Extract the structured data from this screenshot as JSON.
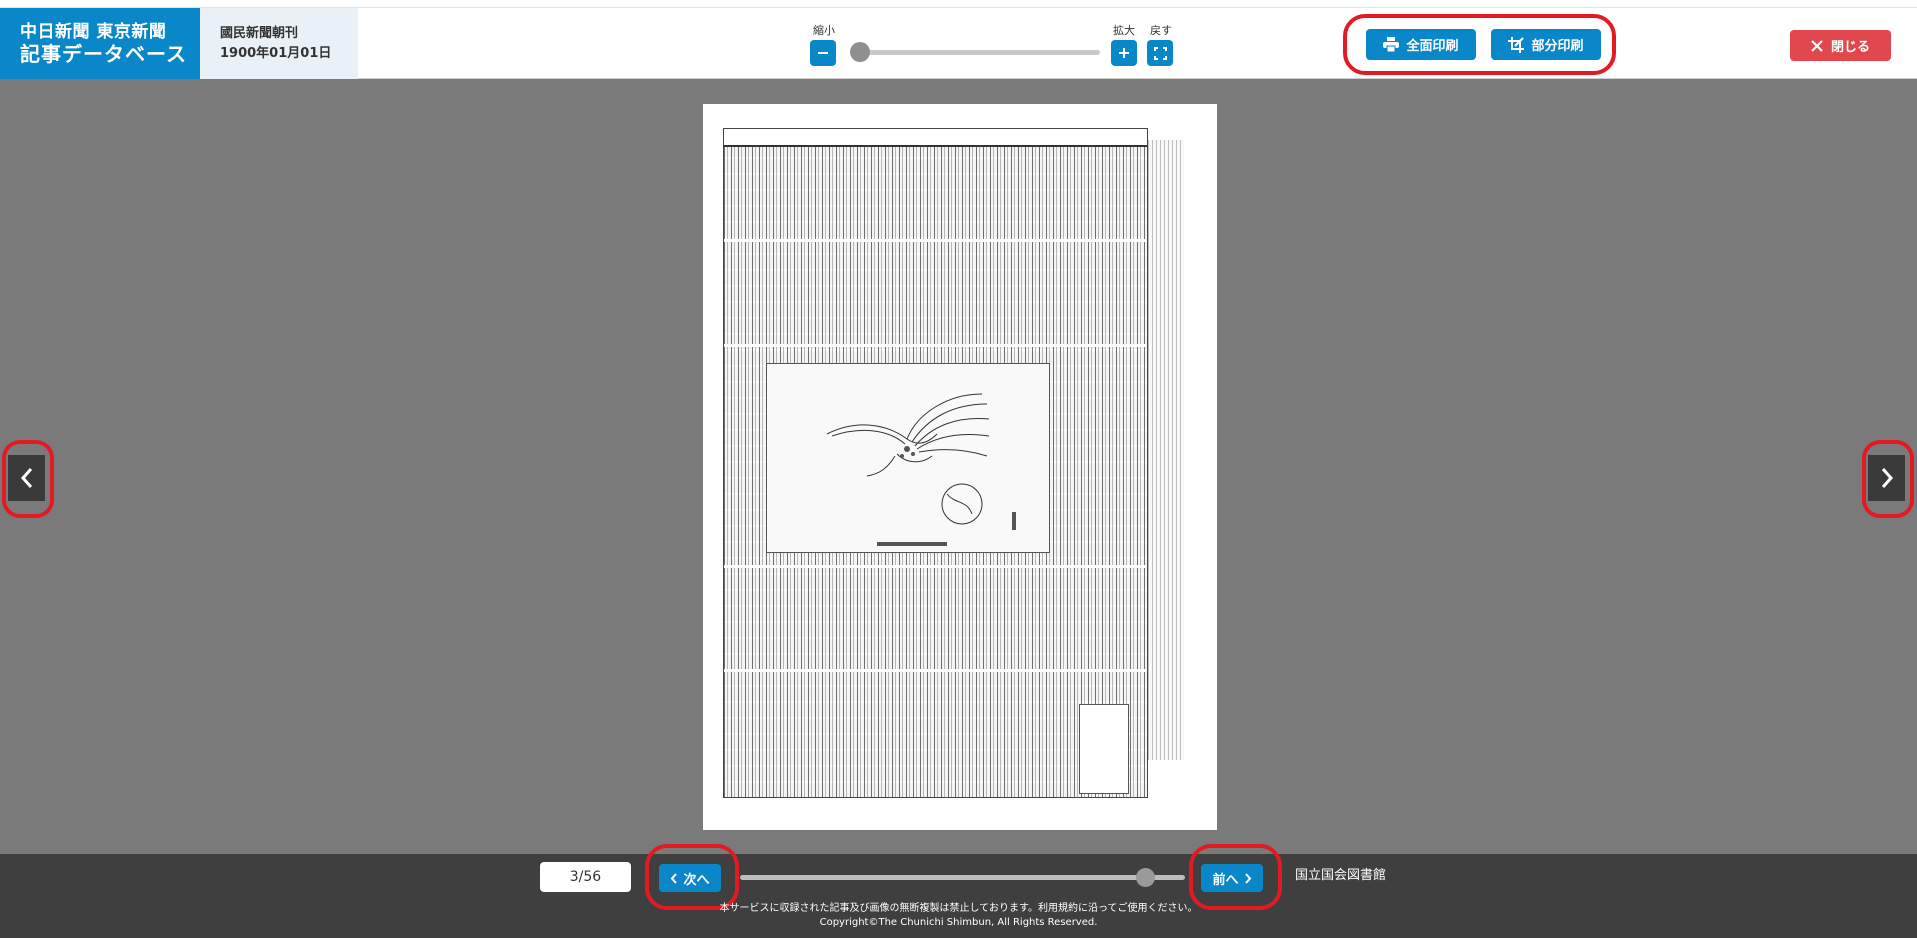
{
  "header": {
    "logo_line1": "中日新聞 東京新聞",
    "logo_line2": "記事データベース",
    "paper_name": "國民新聞朝刊",
    "paper_date": "1900年01月01日"
  },
  "zoom": {
    "zoom_out_label": "縮小",
    "zoom_in_label": "拡大",
    "reset_label": "戻す",
    "level_fraction": 0.0
  },
  "print": {
    "full_print_label": "全面印刷",
    "partial_print_label": "部分印刷"
  },
  "close_label": "閉じる",
  "pager": {
    "page_count": "3/56",
    "next_label": "次へ",
    "prev_label": "前へ",
    "position_fraction": 0.93
  },
  "footer": {
    "library": "国立国会図書館",
    "notice": "本サービスに収録された記事及び画像の無断複製は禁止しております。利用規約に沿ってご使用ください。",
    "copyright": "Copyright©The Chunichi Shimbun, All Rights Reserved."
  },
  "colors": {
    "brand_blue": "#0a87c9",
    "close_red": "#e0484d",
    "highlight_red": "#e21b23"
  },
  "icons": [
    "minus-icon",
    "plus-icon",
    "fullscreen-icon",
    "printer-icon",
    "crop-icon",
    "close-icon",
    "chevron-left-icon",
    "chevron-right-icon"
  ]
}
